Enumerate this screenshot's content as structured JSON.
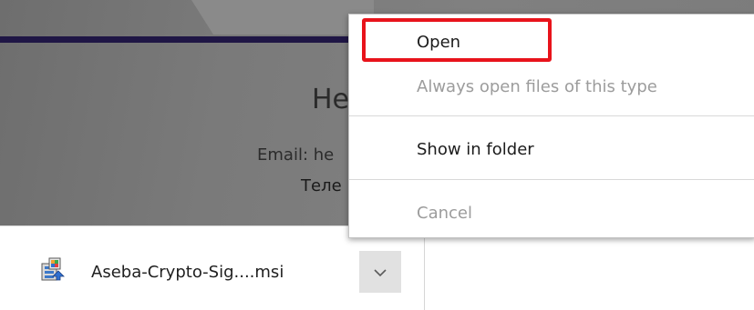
{
  "page": {
    "heading": "He",
    "email": "Email: he",
    "phone": "Теле"
  },
  "download": {
    "file_name": "Aseba-Crypto-Sig....msi",
    "file_icon": "msi-installer-icon",
    "menu_toggle_icon": "chevron-down-icon"
  },
  "context_menu": {
    "items": [
      {
        "label": "Open",
        "enabled": true
      },
      {
        "label": "Always open files of this type",
        "enabled": false
      },
      {
        "label": "Show in folder",
        "enabled": true
      },
      {
        "label": "Cancel",
        "enabled": false
      }
    ]
  },
  "colors": {
    "accent_bar": "#1f1645",
    "highlight": "#e8131b",
    "disabled_text": "#9c9c9c",
    "overlay": "#7a7a7a"
  }
}
